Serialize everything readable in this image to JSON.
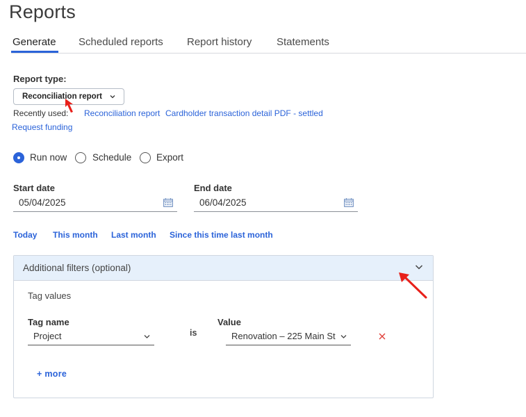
{
  "page": {
    "title": "Reports"
  },
  "tabs": [
    {
      "label": "Generate",
      "active": true
    },
    {
      "label": "Scheduled reports"
    },
    {
      "label": "Report history"
    },
    {
      "label": "Statements"
    }
  ],
  "report_type": {
    "label": "Report type:",
    "selected": "Reconciliation report",
    "recently_used_label": "Recently used:",
    "recent_links": [
      "Reconciliation report",
      "Cardholder transaction detail PDF - settled",
      "Request funding"
    ]
  },
  "run_options": [
    {
      "label": "Run now",
      "checked": true
    },
    {
      "label": "Schedule",
      "checked": false
    },
    {
      "label": "Export",
      "checked": false
    }
  ],
  "dates": {
    "start_label": "Start date",
    "start_value": "05/04/2025",
    "end_label": "End date",
    "end_value": "06/04/2025"
  },
  "quick_ranges": [
    "Today",
    "This month",
    "Last month",
    "Since this time last month"
  ],
  "filters": {
    "title": "Additional filters (optional)",
    "section_label": "Tag values",
    "tag_name_label": "Tag name",
    "tag_name_value": "Project",
    "operator": "is",
    "value_label": "Value",
    "value_value": "Renovation – 225 Main St",
    "more_label": "+ more"
  },
  "colors": {
    "accent": "#2b63d9",
    "annotation": "#e8201a",
    "remove": "#e0403a"
  }
}
